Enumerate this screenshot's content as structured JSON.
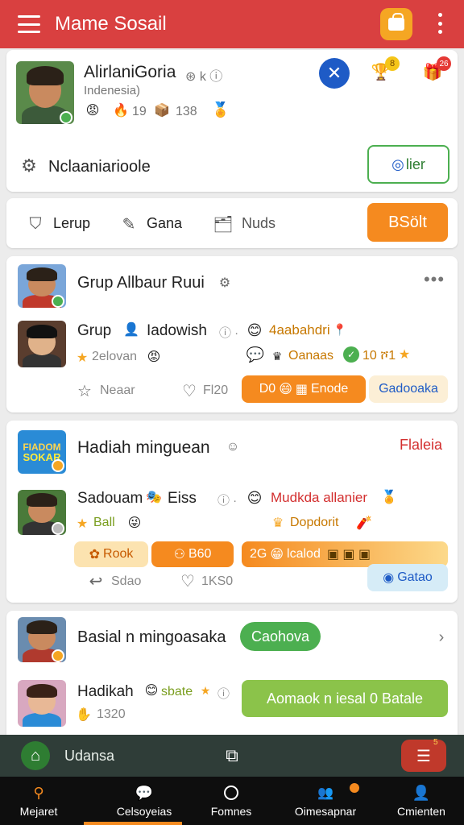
{
  "app": {
    "title": "Mame Sosail"
  },
  "profile": {
    "name": "AlirlaniGoria",
    "name_suffix": "⊛ k ⓘ",
    "location": "Indenesia)",
    "stats": [
      {
        "icon": "😡",
        "value": ""
      },
      {
        "icon": "🔥",
        "value": "19"
      },
      {
        "icon": "📦",
        "value": "138"
      },
      {
        "icon": "🏅",
        "value": ""
      }
    ],
    "badges": [
      "8",
      "26"
    ],
    "section_label": "Nclaaniarioole",
    "follow_button": "lier"
  },
  "tabs": {
    "items": [
      {
        "label": "Lerup"
      },
      {
        "label": "Gana"
      },
      {
        "label": "Nuds"
      }
    ],
    "action": "BSölt"
  },
  "group_card": {
    "title": "Grup Allbaur Ruui",
    "row": {
      "name": "Grup",
      "handle": "Iadowish",
      "meta": "ⓘ ·",
      "reward": "4aabahdri",
      "stars": "2elovan",
      "rank": "Oanaas",
      "level": "10 ሾ1",
      "like_label": "Neaar",
      "time_label": "Fl20",
      "pill_primary": "D0 ",
      "pill_primary_2": "Enode",
      "pill_secondary": "Gadooaka"
    }
  },
  "weekly_card": {
    "logo_top": "FIADOM",
    "logo_bottom": "SOKAR",
    "title": "Hadiah minguean",
    "status": "Flaleia",
    "row": {
      "name": "Sadouam",
      "handle": "Eiss",
      "meta": "ⓘ ·",
      "reward": "Mudkda allanier",
      "stars": "Ball",
      "rank": "Dopdorit",
      "like_label": "Sdao",
      "time_label": "1KS0",
      "pill_a": "Rook",
      "pill_b": "B60",
      "pill_c": "2G",
      "pill_c_2": "lcalod",
      "pill_d": "Gatao"
    }
  },
  "social_card": {
    "title": "Basial n mingoasaka",
    "chip": "Caohova",
    "row": {
      "name": "Hadikah",
      "tag": "sbate",
      "meta": "ⓘ",
      "count": "1320",
      "action": "Aomaok n iesal 0 Batale"
    }
  },
  "bottom_bar": {
    "label": "Udansa",
    "badge": "5"
  },
  "nav": [
    {
      "label": "Mejaret"
    },
    {
      "label": "Celsoyeias"
    },
    {
      "label": "Fomnes"
    },
    {
      "label": "Oimesapnar"
    },
    {
      "label": "Cmienten"
    }
  ],
  "colors": {
    "brand_red": "#d94040",
    "orange": "#f58a1f",
    "green": "#4caf50",
    "lime": "#8bc34a",
    "blue": "#1e5bc6"
  }
}
